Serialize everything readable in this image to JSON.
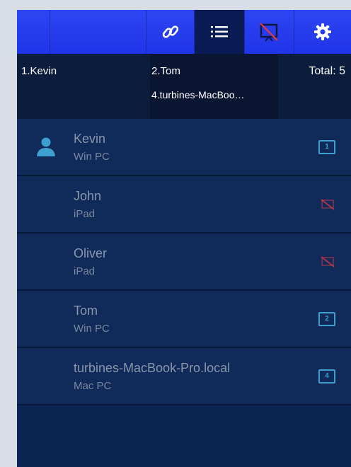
{
  "colors": {
    "toolbar": "#2437ea",
    "active_tool": "#0a1a55",
    "list_bg": "#102a5a",
    "badge": "#3ea0cf",
    "muted_icon": "#b8334b"
  },
  "toolbar": {
    "buttons": [
      {
        "icon": "link-icon",
        "active": false
      },
      {
        "icon": "list-icon",
        "active": true
      },
      {
        "icon": "screen-off-icon",
        "active": false
      },
      {
        "icon": "gear-icon",
        "active": false
      }
    ]
  },
  "presenters": {
    "slot1": "1.Kevin",
    "slot2": "2.Tom",
    "slot4": "4.turbines-MacBoo…",
    "total": "Total: 5"
  },
  "participants": [
    {
      "name": "Kevin",
      "device": "Win PC",
      "badge": "1",
      "status_icon": "screen-number-icon",
      "avatar": true
    },
    {
      "name": "John",
      "device": "iPad",
      "badge": "",
      "status_icon": "screen-off-icon",
      "avatar": false
    },
    {
      "name": "Oliver",
      "device": "iPad",
      "badge": "",
      "status_icon": "screen-off-icon",
      "avatar": false
    },
    {
      "name": "Tom",
      "device": "Win PC",
      "badge": "2",
      "status_icon": "screen-number-icon",
      "avatar": false
    },
    {
      "name": "turbines-MacBook-Pro.local",
      "device": "Mac PC",
      "badge": "4",
      "status_icon": "screen-number-icon",
      "avatar": false
    }
  ]
}
